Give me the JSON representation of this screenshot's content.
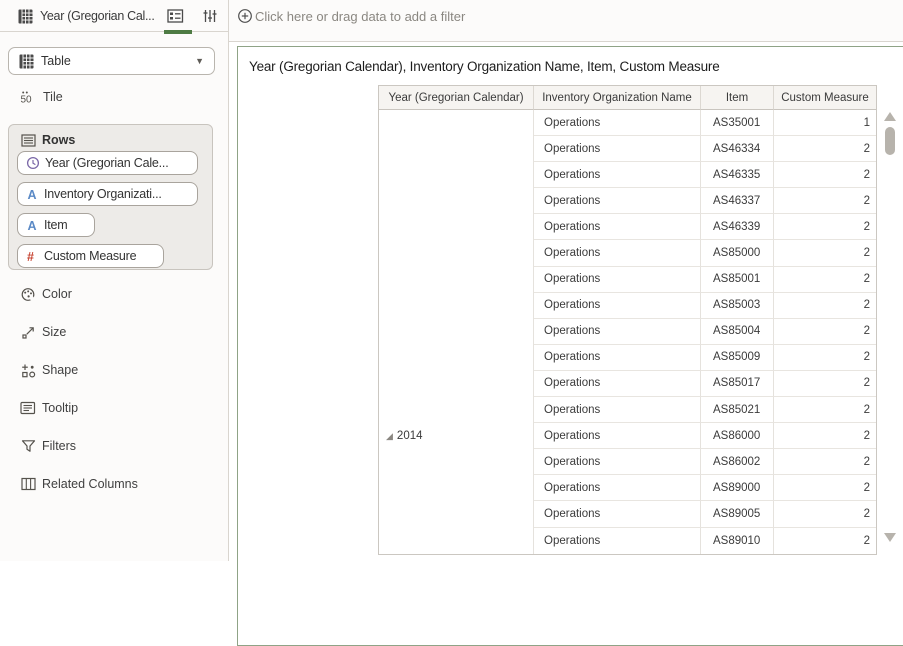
{
  "header": {
    "dataset_title": "Year (Gregorian Cal...",
    "filter_placeholder": "Click here or drag data to add a filter"
  },
  "sidebar": {
    "viz_type_selector": {
      "value": "Table"
    },
    "tile_label": "Tile",
    "rows_section": {
      "label": "Rows",
      "pills": [
        {
          "icon": "clock-icon",
          "label": "Year (Gregorian Cale...",
          "icon_color": "#7b68a8"
        },
        {
          "icon": "text-attribute-icon",
          "label": "Inventory Organizati...",
          "icon_color": "#5b8ac6"
        },
        {
          "icon": "text-attribute-icon",
          "label": "Item",
          "icon_color": "#5b8ac6"
        },
        {
          "icon": "number-icon",
          "label": "Custom Measure",
          "icon_color": "#c74634"
        }
      ]
    },
    "items": [
      {
        "icon": "color-icon",
        "label": "Color"
      },
      {
        "icon": "size-icon",
        "label": "Size"
      },
      {
        "icon": "shape-icon",
        "label": "Shape"
      },
      {
        "icon": "tooltip-icon",
        "label": "Tooltip"
      },
      {
        "icon": "filters-icon",
        "label": "Filters"
      },
      {
        "icon": "related-columns-icon",
        "label": "Related Columns"
      }
    ]
  },
  "viz": {
    "title": "Year (Gregorian Calendar), Inventory Organization Name, Item, Custom Measure",
    "table": {
      "columns": [
        "Year (Gregorian Calendar)",
        "Inventory Organization Name",
        "Item",
        "Custom Measure"
      ],
      "year_group": {
        "label": "2014",
        "row_index": 12
      },
      "rows": [
        {
          "org": "Operations",
          "item": "AS35001",
          "value": "1"
        },
        {
          "org": "Operations",
          "item": "AS46334",
          "value": "2"
        },
        {
          "org": "Operations",
          "item": "AS46335",
          "value": "2"
        },
        {
          "org": "Operations",
          "item": "AS46337",
          "value": "2"
        },
        {
          "org": "Operations",
          "item": "AS46339",
          "value": "2"
        },
        {
          "org": "Operations",
          "item": "AS85000",
          "value": "2"
        },
        {
          "org": "Operations",
          "item": "AS85001",
          "value": "2"
        },
        {
          "org": "Operations",
          "item": "AS85003",
          "value": "2"
        },
        {
          "org": "Operations",
          "item": "AS85004",
          "value": "2"
        },
        {
          "org": "Operations",
          "item": "AS85009",
          "value": "2"
        },
        {
          "org": "Operations",
          "item": "AS85017",
          "value": "2"
        },
        {
          "org": "Operations",
          "item": "AS85021",
          "value": "2"
        },
        {
          "org": "Operations",
          "item": "AS86000",
          "value": "2"
        },
        {
          "org": "Operations",
          "item": "AS86002",
          "value": "2"
        },
        {
          "org": "Operations",
          "item": "AS89000",
          "value": "2"
        },
        {
          "org": "Operations",
          "item": "AS89005",
          "value": "2"
        },
        {
          "org": "Operations",
          "item": "AS89010",
          "value": "2"
        }
      ]
    }
  },
  "colors": {
    "accent_green": "#4e7b43",
    "panel_border_green": "#8fa386",
    "sidebar_bg": "#fcfbfa",
    "header_bg": "#f6f4f1"
  }
}
